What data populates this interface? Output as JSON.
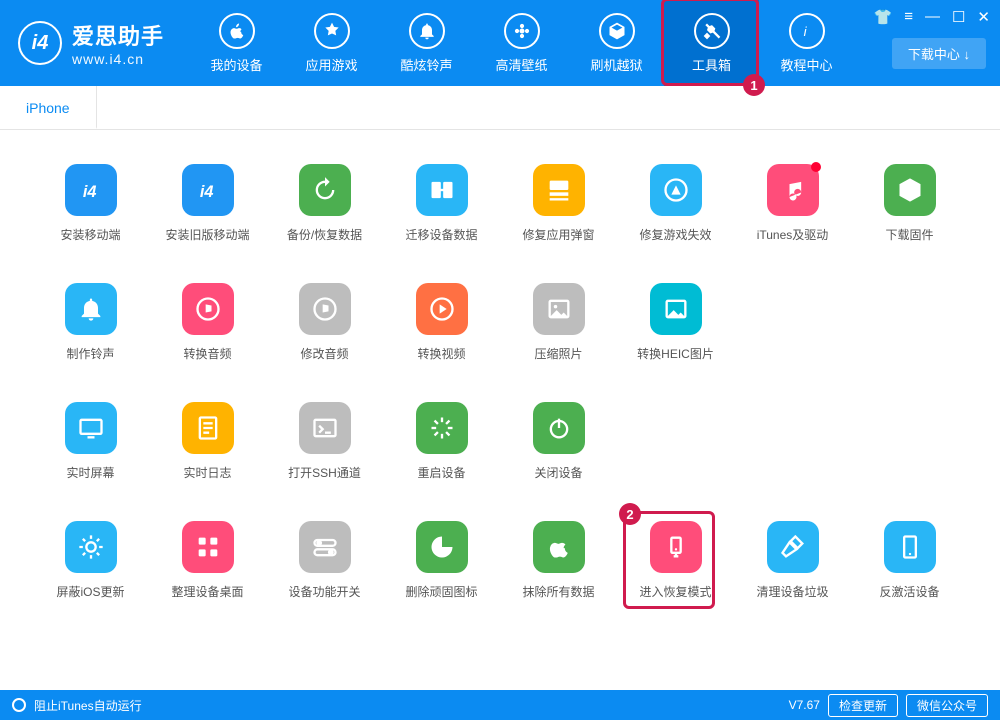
{
  "app": {
    "title": "爱思助手",
    "subtitle": "www.i4.cn",
    "download_center": "下载中心 ↓"
  },
  "nav": {
    "items": [
      {
        "label": "我的设备"
      },
      {
        "label": "应用游戏"
      },
      {
        "label": "酷炫铃声"
      },
      {
        "label": "高清壁纸"
      },
      {
        "label": "刷机越狱"
      },
      {
        "label": "工具箱"
      },
      {
        "label": "教程中心"
      }
    ]
  },
  "tab": {
    "iphone": "iPhone"
  },
  "tools": {
    "r1": [
      {
        "label": "安装移动端"
      },
      {
        "label": "安装旧版移动端"
      },
      {
        "label": "备份/恢复数据"
      },
      {
        "label": "迁移设备数据"
      },
      {
        "label": "修复应用弹窗"
      },
      {
        "label": "修复游戏失效"
      },
      {
        "label": "iTunes及驱动"
      },
      {
        "label": "下载固件"
      }
    ],
    "r2": [
      {
        "label": "制作铃声"
      },
      {
        "label": "转换音频"
      },
      {
        "label": "修改音频"
      },
      {
        "label": "转换视频"
      },
      {
        "label": "压缩照片"
      },
      {
        "label": "转换HEIC图片"
      }
    ],
    "r3": [
      {
        "label": "实时屏幕"
      },
      {
        "label": "实时日志"
      },
      {
        "label": "打开SSH通道"
      },
      {
        "label": "重启设备"
      },
      {
        "label": "关闭设备"
      }
    ],
    "r4": [
      {
        "label": "屏蔽iOS更新"
      },
      {
        "label": "整理设备桌面"
      },
      {
        "label": "设备功能开关"
      },
      {
        "label": "删除顽固图标"
      },
      {
        "label": "抹除所有数据"
      },
      {
        "label": "进入恢复模式"
      },
      {
        "label": "清理设备垃圾"
      },
      {
        "label": "反激活设备"
      }
    ]
  },
  "footer": {
    "block_itunes": "阻止iTunes自动运行",
    "version": "V7.67",
    "check_update": "检查更新",
    "wechat": "微信公众号"
  },
  "badges": {
    "one": "1",
    "two": "2"
  },
  "colors": {
    "row1": [
      "#2196f3",
      "#2196f3",
      "#4caf50",
      "#29b6f6",
      "#ffb300",
      "#29b6f6",
      "#ff4d7a",
      "#4caf50"
    ],
    "row2": [
      "#29b6f6",
      "#ff4d7a",
      "#bdbdbd",
      "#ff7043",
      "#bdbdbd",
      "#00bcd4"
    ],
    "row3": [
      "#29b6f6",
      "#ffb300",
      "#bdbdbd",
      "#4caf50",
      "#4caf50"
    ],
    "row4": [
      "#29b6f6",
      "#ff4d7a",
      "#bdbdbd",
      "#4caf50",
      "#4caf50",
      "#ff4d7a",
      "#29b6f6",
      "#29b6f6"
    ]
  }
}
